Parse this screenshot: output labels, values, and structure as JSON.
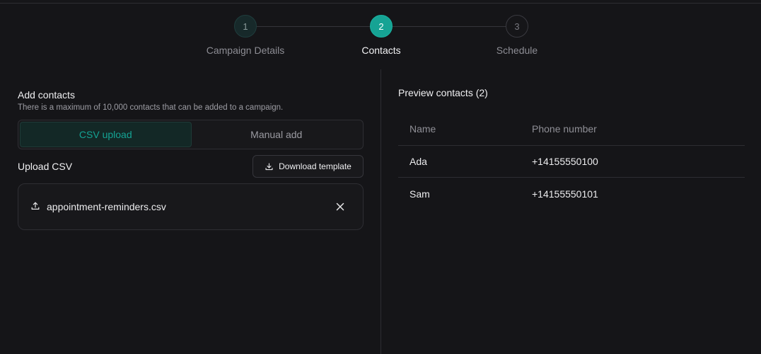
{
  "stepper": {
    "steps": [
      {
        "number": "1",
        "label": "Campaign Details",
        "state": "done"
      },
      {
        "number": "2",
        "label": "Contacts",
        "state": "active"
      },
      {
        "number": "3",
        "label": "Schedule",
        "state": "todo"
      }
    ]
  },
  "add_contacts": {
    "title": "Add contacts",
    "subtitle": "There is a maximum of 10,000 contacts that can be added to a campaign.",
    "tabs": [
      {
        "label": "CSV upload",
        "active": true
      },
      {
        "label": "Manual add",
        "active": false
      }
    ],
    "upload_label": "Upload CSV",
    "download_template_label": "Download template",
    "file_name": "appointment-reminders.csv"
  },
  "preview": {
    "title": "Preview contacts (2)",
    "columns": [
      "Name",
      "Phone number"
    ],
    "rows": [
      [
        "Ada",
        "+14155550100"
      ],
      [
        "Sam",
        "+14155550101"
      ]
    ]
  },
  "colors": {
    "accent": "#16a394",
    "background": "#151518",
    "border": "#2d2d32"
  },
  "icons": {
    "download": "download-icon",
    "upload": "upload-icon",
    "close": "close-icon"
  }
}
